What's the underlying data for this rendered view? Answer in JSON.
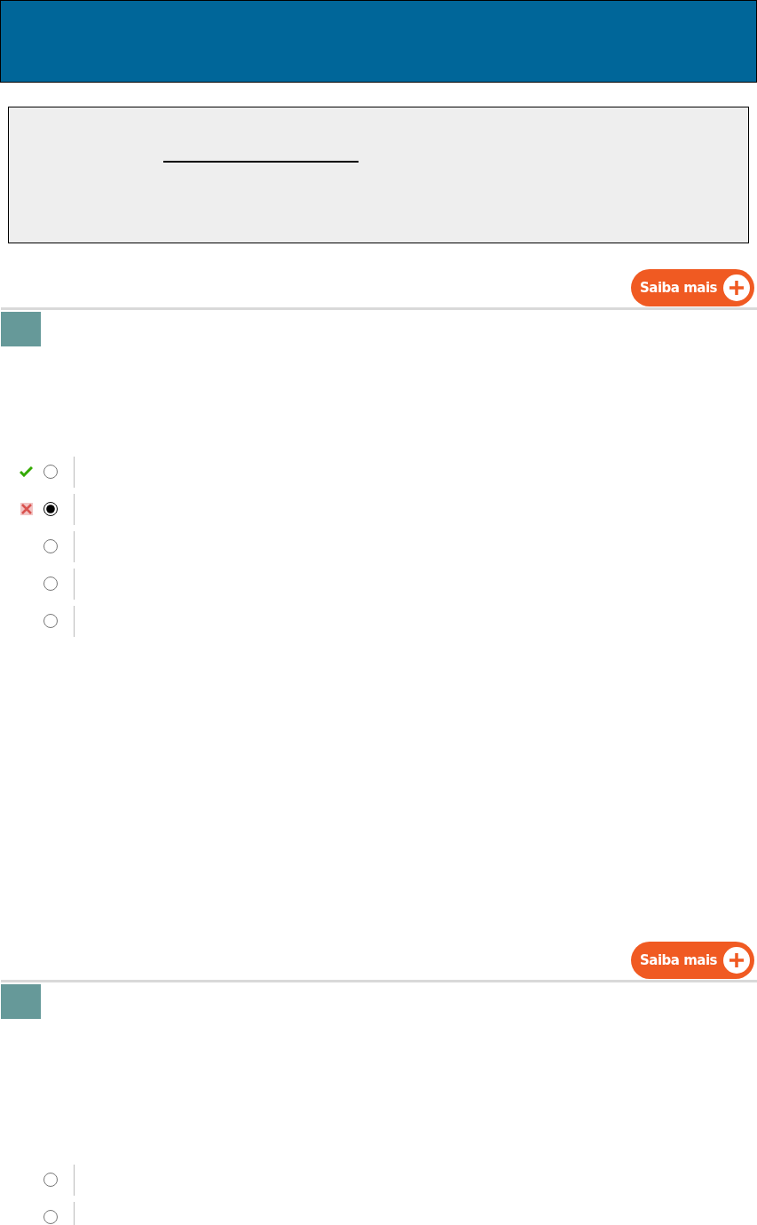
{
  "header": {
    "kind": "banner"
  },
  "questions": [
    {
      "button": "Saiba mais",
      "options": [
        {
          "selected": false,
          "kind": "correct"
        },
        {
          "selected": true,
          "kind": "wrong"
        },
        {
          "selected": false,
          "kind": "plain"
        },
        {
          "selected": false,
          "kind": "plain"
        },
        {
          "selected": false,
          "kind": "plain"
        }
      ]
    },
    {
      "button": "Saiba mais",
      "options": [
        {
          "selected": false,
          "kind": "plain"
        },
        {
          "selected": false,
          "kind": "plain"
        }
      ]
    }
  ]
}
